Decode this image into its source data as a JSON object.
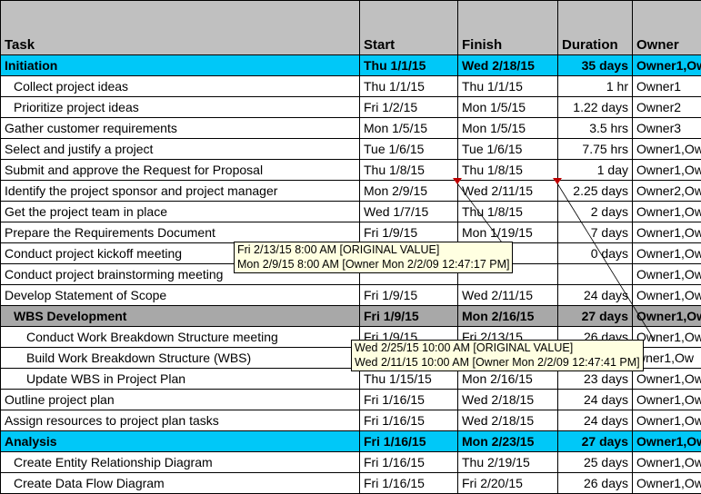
{
  "headers": {
    "task": "Task",
    "start": "Start",
    "finish": "Finish",
    "duration": "Duration",
    "owner": "Owner"
  },
  "rows": [
    {
      "cls": "bold cyan",
      "ind": 0,
      "task": "Initiation",
      "start": "Thu 1/1/15",
      "finish": "Wed 2/18/15",
      "duration": "35 days",
      "owner": "Owner1,Ow"
    },
    {
      "cls": "",
      "ind": 1,
      "task": "Collect project ideas",
      "start": "Thu 1/1/15",
      "finish": "Thu 1/1/15",
      "duration": "1 hr",
      "owner": "Owner1"
    },
    {
      "cls": "",
      "ind": 1,
      "task": "Prioritize project ideas",
      "start": "Fri 1/2/15",
      "finish": "Mon 1/5/15",
      "duration": "1.22 days",
      "owner": "Owner2"
    },
    {
      "cls": "",
      "ind": 0,
      "task": "Gather customer requirements",
      "start": "Mon 1/5/15",
      "finish": "Mon 1/5/15",
      "duration": "3.5 hrs",
      "owner": "Owner3"
    },
    {
      "cls": "",
      "ind": 0,
      "task": "Select and justify a project",
      "start": "Tue 1/6/15",
      "finish": "Tue 1/6/15",
      "duration": "7.75 hrs",
      "owner": "Owner1,Ow"
    },
    {
      "cls": "",
      "ind": 0,
      "task": "Submit and approve the Request for Proposal",
      "start": "Thu 1/8/15",
      "finish": "Thu 1/8/15",
      "duration": "1 day",
      "owner": "Owner1,Ow"
    },
    {
      "cls": "",
      "ind": 0,
      "task": "Identify the project sponsor and project manager",
      "start": "Mon 2/9/15",
      "finish": "Wed 2/11/15",
      "duration": "2.25 days",
      "owner": "Owner2,Ow"
    },
    {
      "cls": "",
      "ind": 0,
      "task": "Get the project team in place",
      "start": "Wed 1/7/15",
      "finish": "Thu 1/8/15",
      "duration": "2 days",
      "owner": "Owner1,Ow"
    },
    {
      "cls": "",
      "ind": 0,
      "task": "Prepare the Requirements Document",
      "start": "Fri 1/9/15",
      "finish": "Mon 1/19/15",
      "duration": "7 days",
      "owner": "Owner1,Ow"
    },
    {
      "cls": "",
      "ind": 0,
      "task": "Conduct project kickoff meeting",
      "start": "",
      "finish": "",
      "duration": "0 days",
      "owner": "Owner1,Ow"
    },
    {
      "cls": "",
      "ind": 0,
      "task": "Conduct project brainstorming meeting",
      "start": "",
      "finish": "",
      "duration": "",
      "owner": "Owner1,Ow"
    },
    {
      "cls": "",
      "ind": 0,
      "task": "Develop Statement of Scope",
      "start": "Fri 1/9/15",
      "finish": "Wed 2/11/15",
      "duration": "24 days",
      "owner": "Owner1,Ow"
    },
    {
      "cls": "bold gray",
      "ind": 1,
      "task": "WBS Development",
      "start": "Fri 1/9/15",
      "finish": "Mon 2/16/15",
      "duration": "27 days",
      "owner": "Owner1,Ow"
    },
    {
      "cls": "",
      "ind": 2,
      "task": "Conduct Work Breakdown Structure meeting",
      "start": "Fri 1/9/15",
      "finish": "Fri 2/13/15",
      "duration": "26 days",
      "owner": "Owner1,Ow"
    },
    {
      "cls": "",
      "ind": 2,
      "task": "Build Work Breakdown Structure (WBS)",
      "start": "",
      "finish": "",
      "duration": "",
      "owner": "wner1,Ow"
    },
    {
      "cls": "",
      "ind": 2,
      "task": "Update WBS in Project Plan",
      "start": "Thu 1/15/15",
      "finish": "Mon 2/16/15",
      "duration": "23 days",
      "owner": "Owner1,Ow"
    },
    {
      "cls": "",
      "ind": 0,
      "task": "Outline project plan",
      "start": "Fri 1/16/15",
      "finish": "Wed 2/18/15",
      "duration": "24 days",
      "owner": "Owner1,Ow"
    },
    {
      "cls": "",
      "ind": 0,
      "task": "Assign resources to project plan tasks",
      "start": "Fri 1/16/15",
      "finish": "Wed 2/18/15",
      "duration": "24 days",
      "owner": "Owner1,Ow"
    },
    {
      "cls": "bold cyan",
      "ind": 0,
      "task": "Analysis",
      "start": "Fri 1/16/15",
      "finish": "Mon 2/23/15",
      "duration": "27 days",
      "owner": "Owner1,Ow"
    },
    {
      "cls": "",
      "ind": 1,
      "task": "Create Entity Relationship Diagram",
      "start": "Fri 1/16/15",
      "finish": "Thu 2/19/15",
      "duration": "25 days",
      "owner": "Owner1,Ow"
    },
    {
      "cls": "",
      "ind": 1,
      "task": "Create Data Flow Diagram",
      "start": "Fri 1/16/15",
      "finish": "Fri 2/20/15",
      "duration": "26 days",
      "owner": "Owner1,Ow"
    }
  ],
  "tooltips": {
    "t1": {
      "line1": "Fri 2/13/15 8:00 AM [ORIGINAL VALUE]",
      "line2": "Mon 2/9/15 8:00 AM [Owner Mon 2/2/09 12:47:17 PM]"
    },
    "t2": {
      "line1": "Wed 2/25/15 10:00 AM [ORIGINAL VALUE]",
      "line2": "Wed 2/11/15 10:00 AM [Owner Mon 2/2/09 12:47:41 PM]"
    }
  }
}
